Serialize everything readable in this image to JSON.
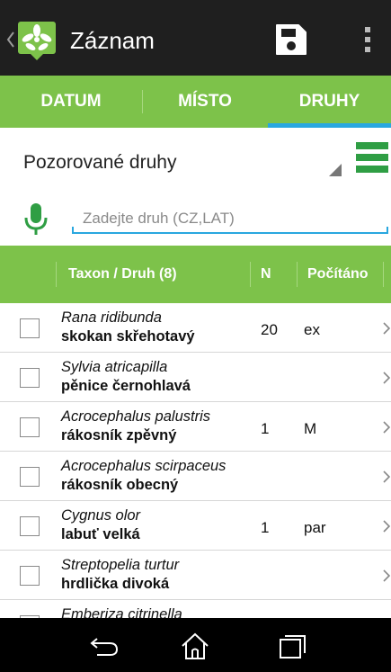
{
  "actionbar": {
    "title": "Záznam",
    "icons": {
      "back": "chevron-left-icon",
      "logo": "app-logo-icon",
      "save": "save-icon",
      "overflow": "more-vert-icon"
    }
  },
  "tabs": [
    {
      "label": "DATUM",
      "active": false
    },
    {
      "label": "MÍSTO",
      "active": false
    },
    {
      "label": "DRUHY",
      "active": true
    }
  ],
  "colors": {
    "accent_green": "#7dc24a",
    "indicator_blue": "#29a7df",
    "mic_green": "#2f9e44",
    "actionbar_bg": "#1f1f1f"
  },
  "spinner": {
    "selected": "Pozorované druhy"
  },
  "search": {
    "placeholder": "Zadejte druh (CZ,LAT)",
    "value": ""
  },
  "table": {
    "headers": {
      "taxon": "Taxon / Druh (8)",
      "n": "N",
      "count": "Počítáno"
    },
    "rows": [
      {
        "latin": "Rana ridibunda",
        "czech": "skokan skřehotavý",
        "n": "20",
        "count": "ex"
      },
      {
        "latin": "Sylvia atricapilla",
        "czech": "pěnice černohlavá",
        "n": "",
        "count": ""
      },
      {
        "latin": "Acrocephalus palustris",
        "czech": "rákosník zpěvný",
        "n": "1",
        "count": "M"
      },
      {
        "latin": "Acrocephalus scirpaceus",
        "czech": "rákosník obecný",
        "n": "",
        "count": ""
      },
      {
        "latin": "Cygnus olor",
        "czech": "labuť velká",
        "n": "1",
        "count": "par"
      },
      {
        "latin": "Streptopelia turtur",
        "czech": "hrdlička divoká",
        "n": "",
        "count": ""
      },
      {
        "latin": "Emberiza citrinella",
        "czech": "",
        "n": "",
        "count": ""
      }
    ]
  },
  "navbar": {
    "icons": [
      "back-icon",
      "home-icon",
      "recents-icon"
    ]
  }
}
